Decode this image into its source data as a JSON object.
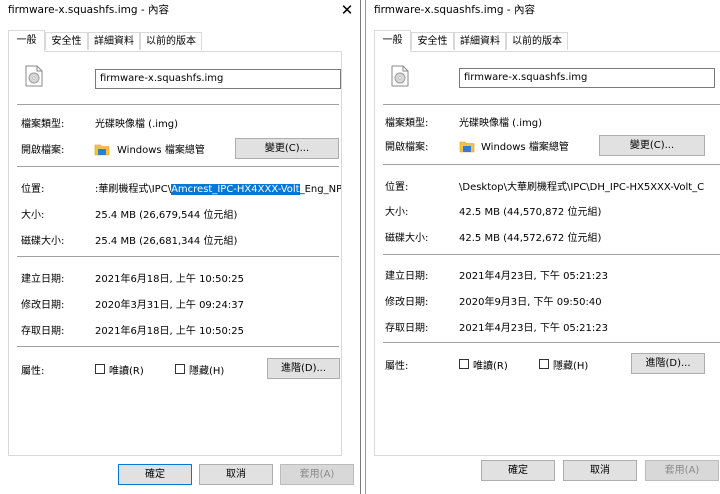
{
  "left": {
    "title": "firmware-x.squashfs.img - 內容",
    "tabs": [
      "一般",
      "安全性",
      "詳細資料",
      "以前的版本"
    ],
    "filename": "firmware-x.squashfs.img",
    "file_type_label": "檔案類型:",
    "file_type_value": "光碟映像檔 (.img)",
    "opens_with_label": "開啟檔案:",
    "opens_with_value": "Windows 檔案總管",
    "change_button": "變更(C)...",
    "location_label": "位置:",
    "location_prefix": ":華刷機程式\\IPC\\",
    "location_selected": "Amcrest_IPC-HX4XXX-Volt",
    "location_suffix": "_Eng_NP",
    "size_label": "大小:",
    "size_value": "25.4 MB (26,679,544 位元組)",
    "disk_size_label": "磁碟大小:",
    "disk_size_value": "25.4 MB (26,681,344 位元組)",
    "created_label": "建立日期:",
    "created_value": "2021年6月18日, 上午 10:50:25",
    "modified_label": "修改日期:",
    "modified_value": "2020年3月31日, 上午 09:24:37",
    "accessed_label": "存取日期:",
    "accessed_value": "2021年6月18日, 上午 10:50:25",
    "attributes_label": "屬性:",
    "readonly_label": "唯讀(R)",
    "hidden_label": "隱藏(H)",
    "advanced_button": "進階(D)...",
    "ok_button": "確定",
    "cancel_button": "取消",
    "apply_button": "套用(A)"
  },
  "right": {
    "title": "firmware-x.squashfs.img - 內容",
    "tabs": [
      "一般",
      "安全性",
      "詳細資料",
      "以前的版本"
    ],
    "filename": "firmware-x.squashfs.img",
    "file_type_label": "檔案類型:",
    "file_type_value": "光碟映像檔 (.img)",
    "opens_with_label": "開啟檔案:",
    "opens_with_value": "Windows 檔案總管",
    "change_button": "變更(C)...",
    "location_label": "位置:",
    "location_value": "\\Desktop\\大華刷機程式\\IPC\\DH_IPC-HX5XXX-Volt_C",
    "size_label": "大小:",
    "size_value": "42.5 MB (44,570,872 位元組)",
    "disk_size_label": "磁碟大小:",
    "disk_size_value": "42.5 MB (44,572,672 位元組)",
    "created_label": "建立日期:",
    "created_value": "2021年4月23日, 下午 05:21:23",
    "modified_label": "修改日期:",
    "modified_value": "2020年9月3日, 下午 09:50:40",
    "accessed_label": "存取日期:",
    "accessed_value": "2021年4月23日, 下午 05:21:23",
    "attributes_label": "屬性:",
    "readonly_label": "唯讀(R)",
    "hidden_label": "隱藏(H)",
    "advanced_button": "進階(D)...",
    "ok_button": "確定",
    "cancel_button": "取消",
    "apply_button": "套用(A)"
  },
  "colors": {
    "selection": "#0078d7",
    "button_face": "#e1e1e1",
    "border": "#adadad"
  }
}
